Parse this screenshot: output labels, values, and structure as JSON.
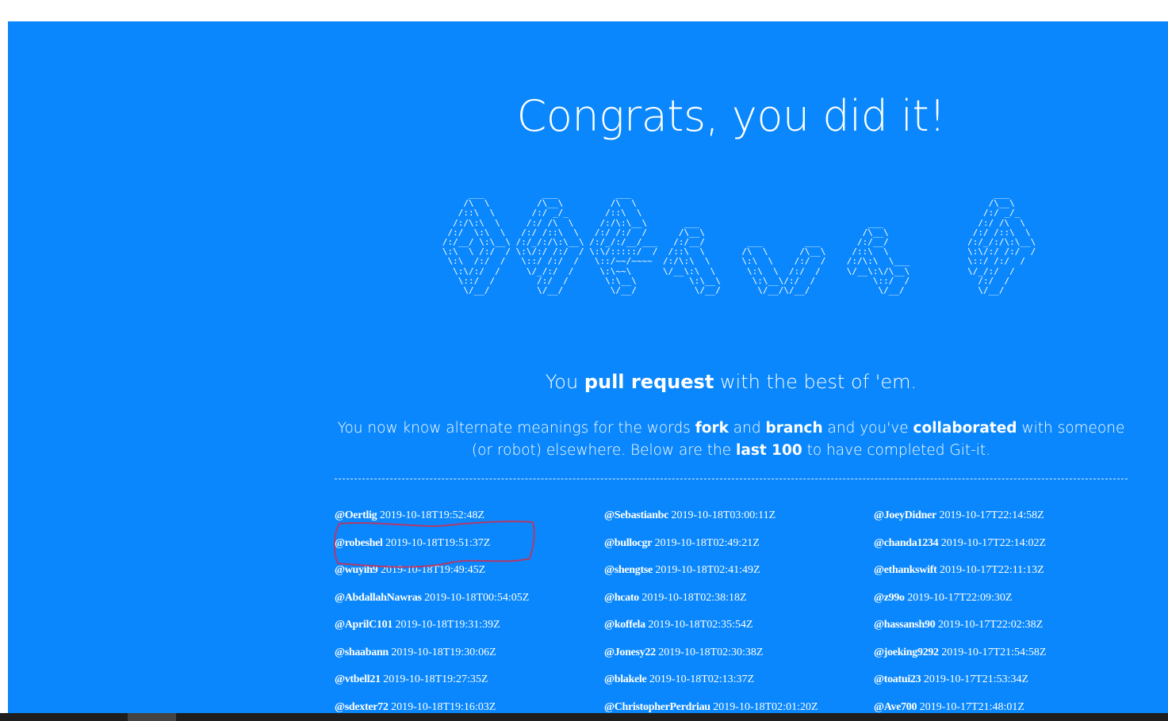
{
  "page": {
    "headline": "Congrats, you did it!",
    "ascii_art": "        ___           ___           ___                                                                     ___     \n       /\\  \\         /\\__\\         /\\  \\                                                                   /\\__\\    \n      /::\\  \\       /:/ _/_       /::\\  \\                                                                 /:/ _/_   \n     /:/\\:\\  \\     /:/ /\\  \\     /:/\\:\\__\\       ___                                ___                  /:/ /\\  \\  \n    /:/  \\:\\  \\   /:/ /::\\  \\   /:/ /:/  /      /\\__\\                              /\\__\\                /:/ /::\\  \\ \n   /:/__/ \\:\\__\\ /:/_/:/\\:\\__\\ /:/_/:/__/___   /:/__/        ___        ___       /:/__/               /:/_/:/\\:\\__\\\n   \\:\\  \\ /:/  / \\:\\/:/ /:/  / \\:\\/:::::/  /  /::\\  \\       /\\  \\      /\\__\\     /::\\  \\               \\:\\/:/ /:/  /\n    \\:\\  /:/  /   \\::/ /:/  /   \\::/~~/~~~~  /:/\\:\\  \\      \\:\\  \\    /:/  /    /:/\\:\\  \\___           \\::/ /:/  / \n     \\:\\/:/  /     \\/_/:/  /     \\:\\~~\\      \\/__\\:\\  \\      \\:\\  \\  /:/  /     \\/__\\:\\/\\__\\           \\/_/:/  /  \n      \\::/  /        /:/  /       \\:\\__\\          \\:\\__\\      \\:\\__\\/:/  /           \\::/  /             /:/  /   \n       \\/__/         \\/__/         \\/__/           \\/__/       \\/__/\\/__/             \\/__/              \\/__/    ",
    "tagline_prefix": "You ",
    "tagline_emphasis": "pull request",
    "tagline_suffix": " with the best of 'em.",
    "intro": {
      "t1": "You now know alternate meanings for the words ",
      "b1": "fork",
      "t2": " and ",
      "b2": "branch",
      "t3": " and you've ",
      "b3": "collaborated",
      "t4": " with someone (or robot) elsewhere. Below are the ",
      "b4": "last 100",
      "t5": " to have completed Git-it."
    }
  },
  "completers": {
    "col1": [
      {
        "user": "@Oertlig",
        "time": "2019-10-18T19:52:48Z"
      },
      {
        "user": "@robeshel",
        "time": "2019-10-18T19:51:37Z"
      },
      {
        "user": "@wuyih9",
        "time": "2019-10-18T19:49:45Z"
      },
      {
        "user": "@AbdallahNawras",
        "time": "2019-10-18T00:54:05Z"
      },
      {
        "user": "@AprilC101",
        "time": "2019-10-18T19:31:39Z"
      },
      {
        "user": "@shaabann",
        "time": "2019-10-18T19:30:06Z"
      },
      {
        "user": "@vtbell21",
        "time": "2019-10-18T19:27:35Z"
      },
      {
        "user": "@sdexter72",
        "time": "2019-10-18T19:16:03Z"
      }
    ],
    "col2": [
      {
        "user": "@Sebastianbc",
        "time": "2019-10-18T03:00:11Z"
      },
      {
        "user": "@bullocgr",
        "time": "2019-10-18T02:49:21Z"
      },
      {
        "user": "@shengtse",
        "time": "2019-10-18T02:41:49Z"
      },
      {
        "user": "@hcato",
        "time": "2019-10-18T02:38:18Z"
      },
      {
        "user": "@koffela",
        "time": "2019-10-18T02:35:54Z"
      },
      {
        "user": "@Jonesy22",
        "time": "2019-10-18T02:30:38Z"
      },
      {
        "user": "@blakele",
        "time": "2019-10-18T02:13:37Z"
      },
      {
        "user": "@ChristopherPerdriau",
        "time": "2019-10-18T02:01:20Z"
      }
    ],
    "col3": [
      {
        "user": "@JoeyDidner",
        "time": "2019-10-17T22:14:58Z"
      },
      {
        "user": "@chanda1234",
        "time": "2019-10-17T22:14:02Z"
      },
      {
        "user": "@ethankswift",
        "time": "2019-10-17T22:11:13Z"
      },
      {
        "user": "@z99o",
        "time": "2019-10-17T22:09:30Z"
      },
      {
        "user": "@hassansh90",
        "time": "2019-10-17T22:02:38Z"
      },
      {
        "user": "@joeking9292",
        "time": "2019-10-17T21:54:58Z"
      },
      {
        "user": "@toatui23",
        "time": "2019-10-17T21:53:34Z"
      },
      {
        "user": "@Ave700",
        "time": "2019-10-17T21:48:01Z"
      }
    ]
  },
  "colors": {
    "background": "#0a87fd",
    "text": "#ffffff",
    "annotation": "#b03a6a"
  }
}
